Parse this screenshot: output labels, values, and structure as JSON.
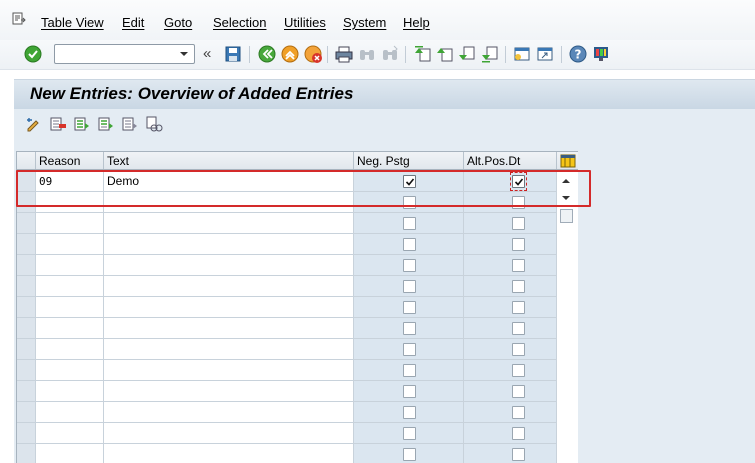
{
  "menu": {
    "items": [
      {
        "label": "Table View"
      },
      {
        "label": "Edit"
      },
      {
        "label": "Goto"
      },
      {
        "label": "Selection"
      },
      {
        "label": "Utilities"
      },
      {
        "label": "System"
      },
      {
        "label": "Help"
      }
    ]
  },
  "toolbar": {
    "command_field": {
      "value": "",
      "placeholder": ""
    },
    "icons": [
      "enter-icon",
      "dropdown-icon",
      "collapse-icon",
      "save-icon",
      "back-icon",
      "exit-icon",
      "cancel-icon",
      "print-icon",
      "find-icon",
      "find-next-icon",
      "first-page-icon",
      "previous-page-icon",
      "next-page-icon",
      "last-page-icon",
      "create-session-icon",
      "shortcut-icon",
      "help-icon",
      "customize-layout-icon"
    ]
  },
  "screen": {
    "title": "New Entries: Overview of Added Entries",
    "app_toolbar_icons": [
      "change-display-icon",
      "delete-icon",
      "select-all-icon",
      "select-block-icon",
      "deselect-all-icon",
      "copy-icon"
    ]
  },
  "table": {
    "headers": {
      "reason": "Reason",
      "text": "Text",
      "neg_pstg": "Neg. Pstg",
      "alt_pos_dt": "Alt.Pos.Dt"
    },
    "rows": [
      {
        "reason": "09",
        "text": "Demo",
        "neg_pstg": true,
        "alt_pos_dt": true
      },
      {
        "reason": "",
        "text": "",
        "neg_pstg": false,
        "alt_pos_dt": false
      },
      {
        "reason": "",
        "text": "",
        "neg_pstg": false,
        "alt_pos_dt": false
      },
      {
        "reason": "",
        "text": "",
        "neg_pstg": false,
        "alt_pos_dt": false
      },
      {
        "reason": "",
        "text": "",
        "neg_pstg": false,
        "alt_pos_dt": false
      },
      {
        "reason": "",
        "text": "",
        "neg_pstg": false,
        "alt_pos_dt": false
      },
      {
        "reason": "",
        "text": "",
        "neg_pstg": false,
        "alt_pos_dt": false
      },
      {
        "reason": "",
        "text": "",
        "neg_pstg": false,
        "alt_pos_dt": false
      },
      {
        "reason": "",
        "text": "",
        "neg_pstg": false,
        "alt_pos_dt": false
      },
      {
        "reason": "",
        "text": "",
        "neg_pstg": false,
        "alt_pos_dt": false
      },
      {
        "reason": "",
        "text": "",
        "neg_pstg": false,
        "alt_pos_dt": false
      },
      {
        "reason": "",
        "text": "",
        "neg_pstg": false,
        "alt_pos_dt": false
      },
      {
        "reason": "",
        "text": "",
        "neg_pstg": false,
        "alt_pos_dt": false
      },
      {
        "reason": "",
        "text": "",
        "neg_pstg": false,
        "alt_pos_dt": false
      }
    ]
  },
  "colors": {
    "highlight": "#d42a2a",
    "title_band": "#c9d7e4",
    "checkbox_column": "#dbe6f0"
  }
}
